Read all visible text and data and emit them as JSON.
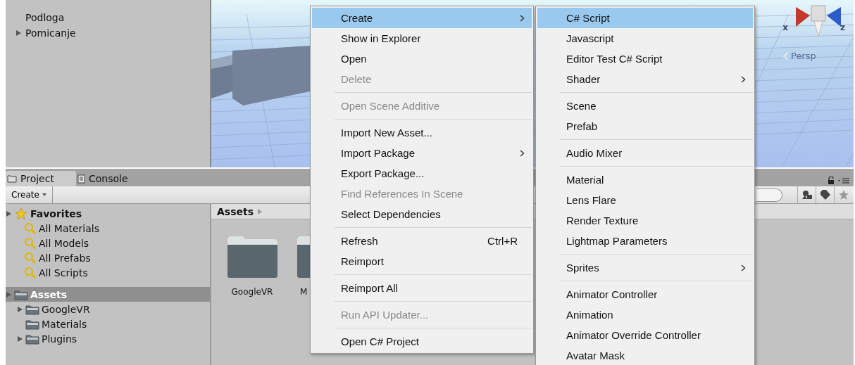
{
  "hierarchy": {
    "items": [
      {
        "label": "Podloga",
        "expandable": false
      },
      {
        "label": "Pomicanje",
        "expandable": true
      }
    ]
  },
  "scene": {
    "gizmo_axes": [
      "x",
      "z"
    ],
    "camera_label": "Persp"
  },
  "bottom_tabs": [
    {
      "label": "Project",
      "selected": true
    },
    {
      "label": "Console",
      "selected": false
    }
  ],
  "toolbar": {
    "create_label": "Create"
  },
  "favorites": {
    "label": "Favorites",
    "items": [
      "All Materials",
      "All Models",
      "All Prefabs",
      "All Scripts"
    ]
  },
  "assets_tree": {
    "label": "Assets",
    "selected": true,
    "children": [
      {
        "label": "GoogleVR",
        "expandable": true
      },
      {
        "label": "Materials",
        "expandable": false
      },
      {
        "label": "Plugins",
        "expandable": true
      }
    ]
  },
  "breadcrumb": "Assets",
  "folders": [
    "GoogleVR",
    "M"
  ],
  "context_menu": [
    {
      "kind": "item",
      "label": "Create",
      "submenu": true,
      "selected": true,
      "disabled": false
    },
    {
      "kind": "item",
      "label": "Show in Explorer",
      "selected": false,
      "disabled": false
    },
    {
      "kind": "item",
      "label": "Open",
      "selected": false,
      "disabled": false
    },
    {
      "kind": "item",
      "label": "Delete",
      "selected": false,
      "disabled": true
    },
    {
      "kind": "separator"
    },
    {
      "kind": "item",
      "label": "Open Scene Additive",
      "selected": false,
      "disabled": true
    },
    {
      "kind": "separator"
    },
    {
      "kind": "item",
      "label": "Import New Asset...",
      "selected": false,
      "disabled": false
    },
    {
      "kind": "item",
      "label": "Import Package",
      "submenu": true,
      "selected": false,
      "disabled": false
    },
    {
      "kind": "item",
      "label": "Export Package...",
      "selected": false,
      "disabled": false
    },
    {
      "kind": "item",
      "label": "Find References In Scene",
      "selected": false,
      "disabled": true
    },
    {
      "kind": "item",
      "label": "Select Dependencies",
      "selected": false,
      "disabled": false
    },
    {
      "kind": "separator"
    },
    {
      "kind": "item",
      "label": "Refresh",
      "shortcut": "Ctrl+R",
      "selected": false,
      "disabled": false
    },
    {
      "kind": "item",
      "label": "Reimport",
      "selected": false,
      "disabled": false
    },
    {
      "kind": "separator"
    },
    {
      "kind": "item",
      "label": "Reimport All",
      "selected": false,
      "disabled": false
    },
    {
      "kind": "separator"
    },
    {
      "kind": "item",
      "label": "Run API Updater...",
      "selected": false,
      "disabled": true
    },
    {
      "kind": "separator"
    },
    {
      "kind": "item",
      "label": "Open C# Project",
      "selected": false,
      "disabled": false
    }
  ],
  "create_submenu": [
    {
      "kind": "item",
      "label": "C# Script",
      "selected": true,
      "disabled": false
    },
    {
      "kind": "item",
      "label": "Javascript",
      "selected": false,
      "disabled": false
    },
    {
      "kind": "item",
      "label": "Editor Test C# Script",
      "selected": false,
      "disabled": false
    },
    {
      "kind": "item",
      "label": "Shader",
      "submenu": true,
      "selected": false,
      "disabled": false
    },
    {
      "kind": "separator"
    },
    {
      "kind": "item",
      "label": "Scene",
      "selected": false,
      "disabled": false
    },
    {
      "kind": "item",
      "label": "Prefab",
      "selected": false,
      "disabled": false
    },
    {
      "kind": "separator"
    },
    {
      "kind": "item",
      "label": "Audio Mixer",
      "selected": false,
      "disabled": false
    },
    {
      "kind": "separator"
    },
    {
      "kind": "item",
      "label": "Material",
      "selected": false,
      "disabled": false
    },
    {
      "kind": "item",
      "label": "Lens Flare",
      "selected": false,
      "disabled": false
    },
    {
      "kind": "item",
      "label": "Render Texture",
      "selected": false,
      "disabled": false
    },
    {
      "kind": "item",
      "label": "Lightmap Parameters",
      "selected": false,
      "disabled": false
    },
    {
      "kind": "separator"
    },
    {
      "kind": "item",
      "label": "Sprites",
      "submenu": true,
      "selected": false,
      "disabled": false
    },
    {
      "kind": "separator"
    },
    {
      "kind": "item",
      "label": "Animator Controller",
      "selected": false,
      "disabled": false
    },
    {
      "kind": "item",
      "label": "Animation",
      "selected": false,
      "disabled": false
    },
    {
      "kind": "item",
      "label": "Animator Override Controller",
      "selected": false,
      "disabled": false
    },
    {
      "kind": "item",
      "label": "Avatar Mask",
      "selected": false,
      "disabled": false
    }
  ]
}
